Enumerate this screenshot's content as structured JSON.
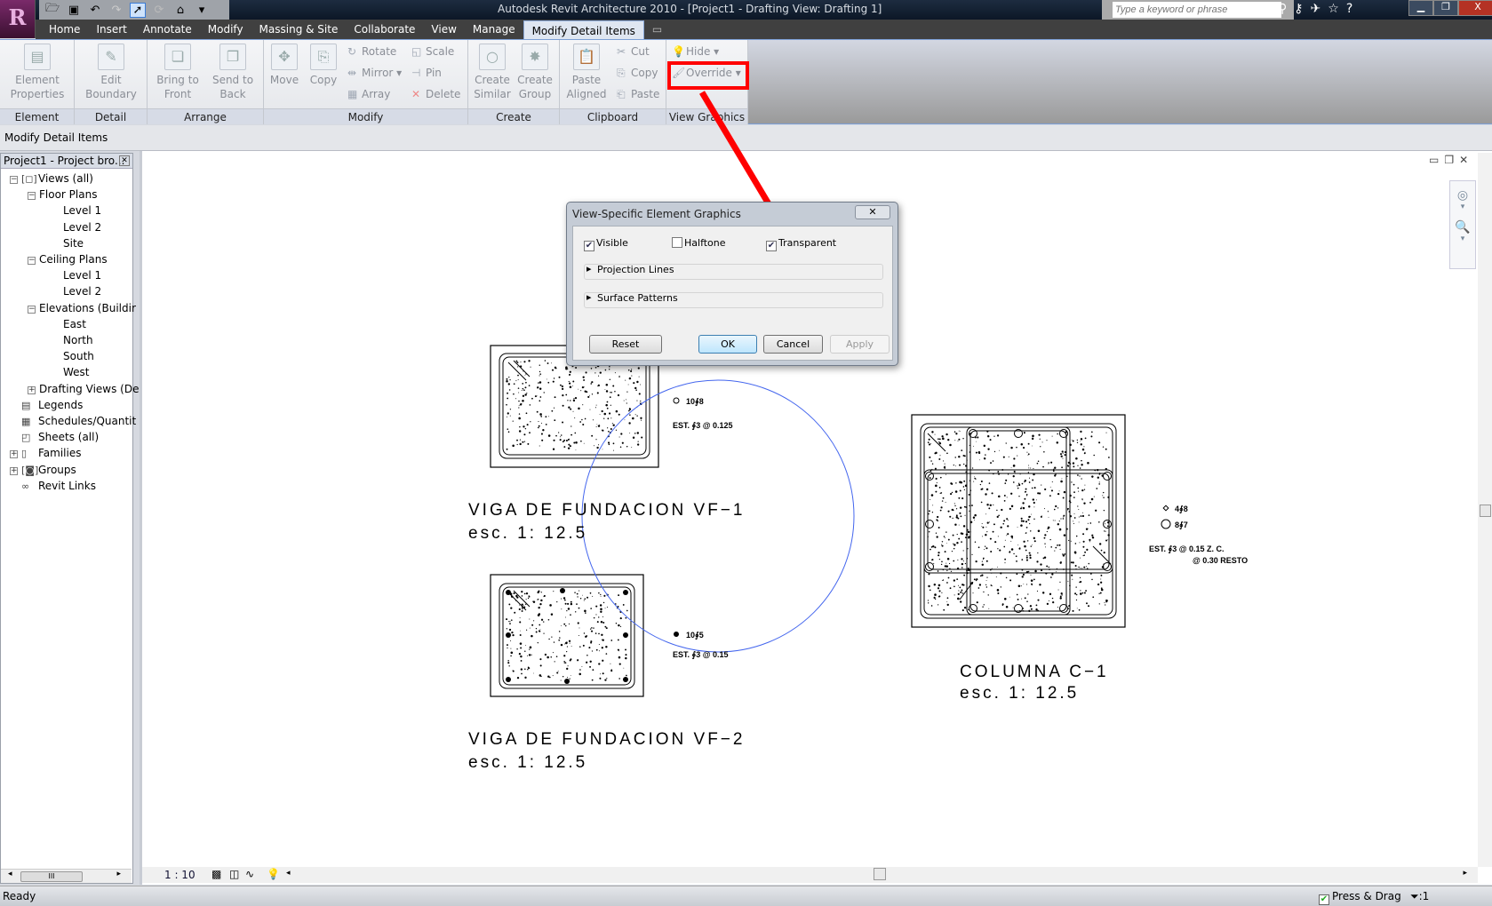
{
  "app": {
    "title": "Autodesk Revit Architecture 2010 - [Project1 - Drafting View: Drafting 1]",
    "logo_letter": "R",
    "search_placeholder": "Type a keyword or phrase"
  },
  "tabs": [
    {
      "label": "Home"
    },
    {
      "label": "Insert"
    },
    {
      "label": "Annotate"
    },
    {
      "label": "Modify"
    },
    {
      "label": "Massing & Site"
    },
    {
      "label": "Collaborate"
    },
    {
      "label": "View"
    },
    {
      "label": "Manage"
    },
    {
      "label": "Modify Detail Items",
      "active": true
    }
  ],
  "ribbon": {
    "panels": {
      "element": "Element",
      "detail": "Detail",
      "arrange": "Arrange",
      "modify": "Modify",
      "create": "Create",
      "clipboard": "Clipboard",
      "view_graphics": "View Graphics"
    },
    "buttons": {
      "element_properties": "Element Properties",
      "edit_boundary": "Edit Boundary",
      "bring_to_front": "Bring to Front",
      "send_to_back": "Send to Back",
      "move": "Move",
      "copy": "Copy",
      "rotate": "Rotate",
      "mirror": "Mirror",
      "array": "Array",
      "scale": "Scale",
      "pin": "Pin",
      "delete": "Delete",
      "create_similar": "Create Similar",
      "create_group": "Create Group",
      "paste_aligned": "Paste Aligned",
      "cut": "Cut",
      "clip_copy": "Copy",
      "paste": "Paste",
      "hide": "Hide",
      "override": "Override"
    },
    "highlight_color": "#ff0000"
  },
  "options_bar": {
    "label": "Modify Detail Items"
  },
  "project_browser": {
    "title": "Project1 - Project bro...",
    "items": [
      {
        "label": "Views (all)",
        "level": 0,
        "expander": "−"
      },
      {
        "label": "Floor Plans",
        "level": 1,
        "expander": "−"
      },
      {
        "label": "Level 1",
        "level": 2
      },
      {
        "label": "Level 2",
        "level": 2
      },
      {
        "label": "Site",
        "level": 2
      },
      {
        "label": "Ceiling Plans",
        "level": 1,
        "expander": "−"
      },
      {
        "label": "Level 1",
        "level": 2
      },
      {
        "label": "Level 2",
        "level": 2
      },
      {
        "label": "Elevations (Buildir",
        "level": 1,
        "expander": "−"
      },
      {
        "label": "East",
        "level": 2
      },
      {
        "label": "North",
        "level": 2
      },
      {
        "label": "South",
        "level": 2
      },
      {
        "label": "West",
        "level": 2
      },
      {
        "label": "Drafting Views (De",
        "level": 1,
        "expander": "+"
      },
      {
        "label": "Legends",
        "level": 0
      },
      {
        "label": "Schedules/Quantit",
        "level": 0
      },
      {
        "label": "Sheets (all)",
        "level": 0
      },
      {
        "label": "Families",
        "level": 0,
        "expander": "+"
      },
      {
        "label": "Groups",
        "level": 0,
        "expander": "+"
      },
      {
        "label": "Revit Links",
        "level": 0
      }
    ]
  },
  "dialog": {
    "title": "View-Specific Element Graphics",
    "checkboxes": [
      {
        "label": "Visible",
        "checked": true
      },
      {
        "label": "Halftone",
        "checked": false
      },
      {
        "label": "Transparent",
        "checked": true
      }
    ],
    "groups": [
      "Projection Lines",
      "Surface Patterns"
    ],
    "buttons": {
      "reset": "Reset",
      "ok": "OK",
      "cancel": "Cancel",
      "apply": "Apply"
    }
  },
  "drawing": {
    "vf1": {
      "title": "VIGA DE FUNDACION VF−1",
      "scale": "esc. 1: 12.5",
      "bars": "10∮8",
      "stirrups": "EST. ∮3 @ 0.125"
    },
    "vf2": {
      "title": "VIGA DE FUNDACION VF−2",
      "scale": "esc. 1: 12.5",
      "bars": "10∮5",
      "stirrups": "EST. ∮3 @ 0.15"
    },
    "c1": {
      "title": "COLUMNA C−1",
      "scale": "esc. 1: 12.5",
      "bars_a": "4∮8",
      "bars_b": "8∮7",
      "stirrups": "EST. ∮3 @ 0.15 Z. C.",
      "stirrups_rest": "@ 0.30 RESTO"
    },
    "selection_circle_color": "#4466ee"
  },
  "view_control": {
    "scale": "1 : 10"
  },
  "status": {
    "text": "Ready",
    "press_drag": "Press & Drag",
    "press_drag_checked": true,
    "filter_count": ":1"
  }
}
